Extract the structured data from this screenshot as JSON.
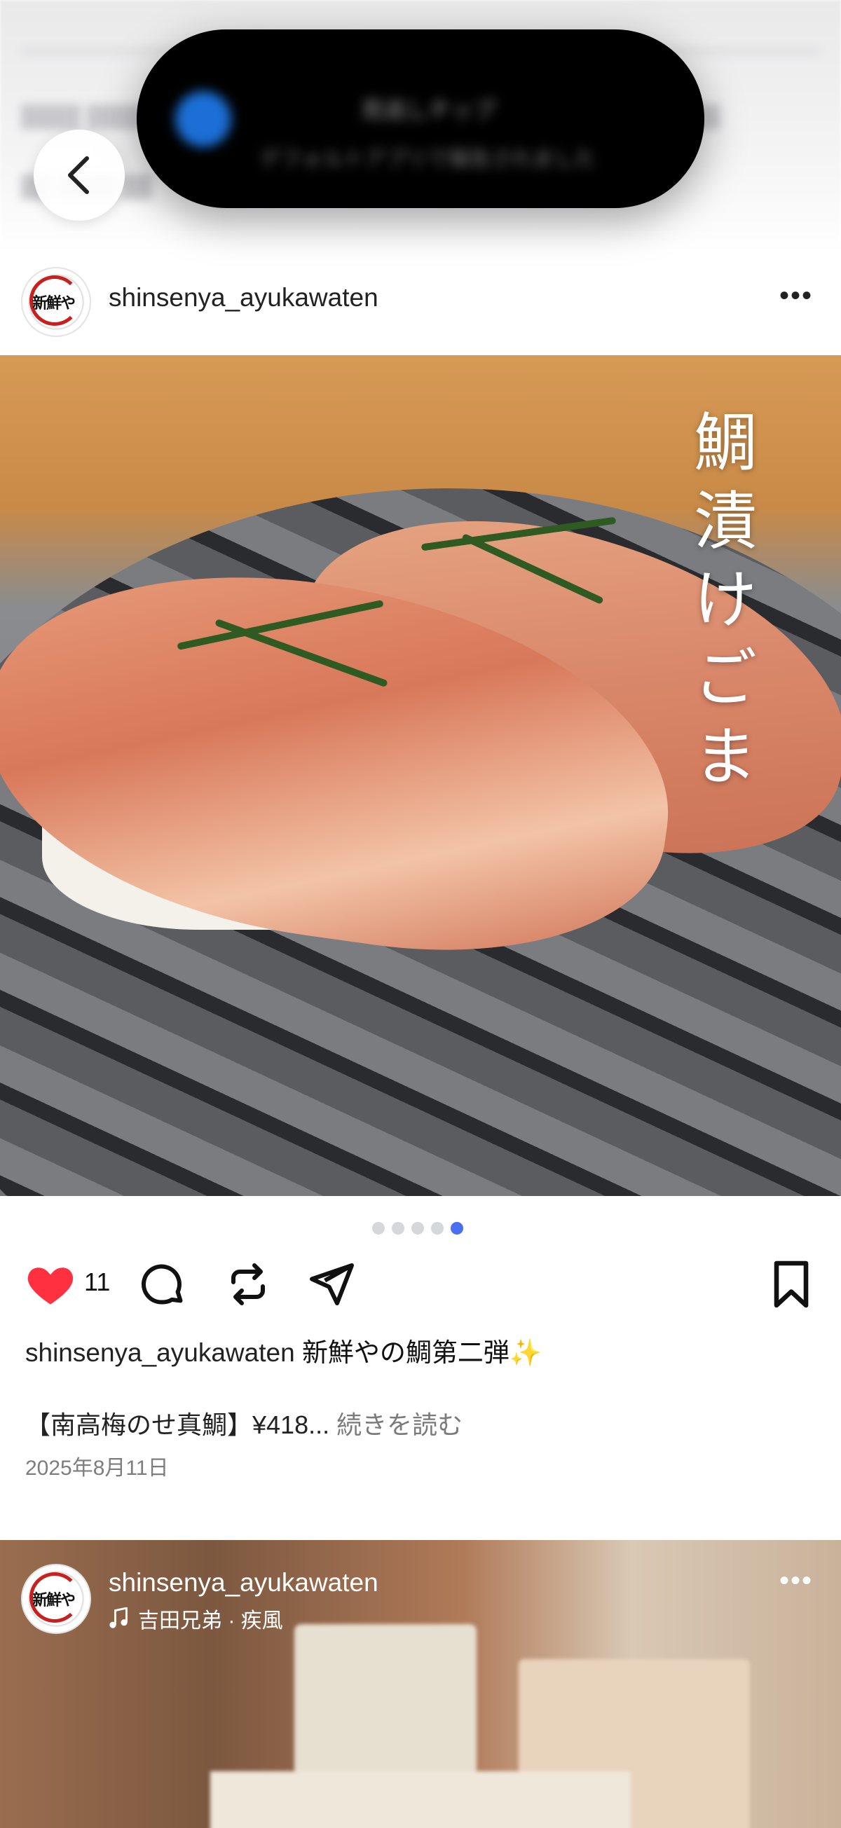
{
  "notification": {
    "title": "見逃しチップ",
    "body": "デフォルトアプリで報告されました"
  },
  "post": {
    "username": "shinsenya_ayukawaten",
    "image_overlay_text": "鯛漬けごま",
    "carousel": {
      "count": 5,
      "active_index": 4
    },
    "likes": "11",
    "caption_username": "shinsenya_ayukawaten",
    "caption_text": "新鮮やの鯛第二弾✨",
    "caption_line2": "【南高梅のせ真鯛】¥418...",
    "read_more": "続きを読む",
    "date": "2025年8月11日"
  },
  "next_post": {
    "username": "shinsenya_ayukawaten",
    "song": "吉田兄弟 · 疾風"
  },
  "colors": {
    "like_red": "#ff3040",
    "carousel_active": "#4a6ff0",
    "text_secondary": "#7d7d7d"
  },
  "icons": [
    "back-chevron-icon",
    "more-dots-icon",
    "heart-icon",
    "comment-icon",
    "repost-icon",
    "share-icon",
    "bookmark-icon",
    "music-note-icon"
  ]
}
